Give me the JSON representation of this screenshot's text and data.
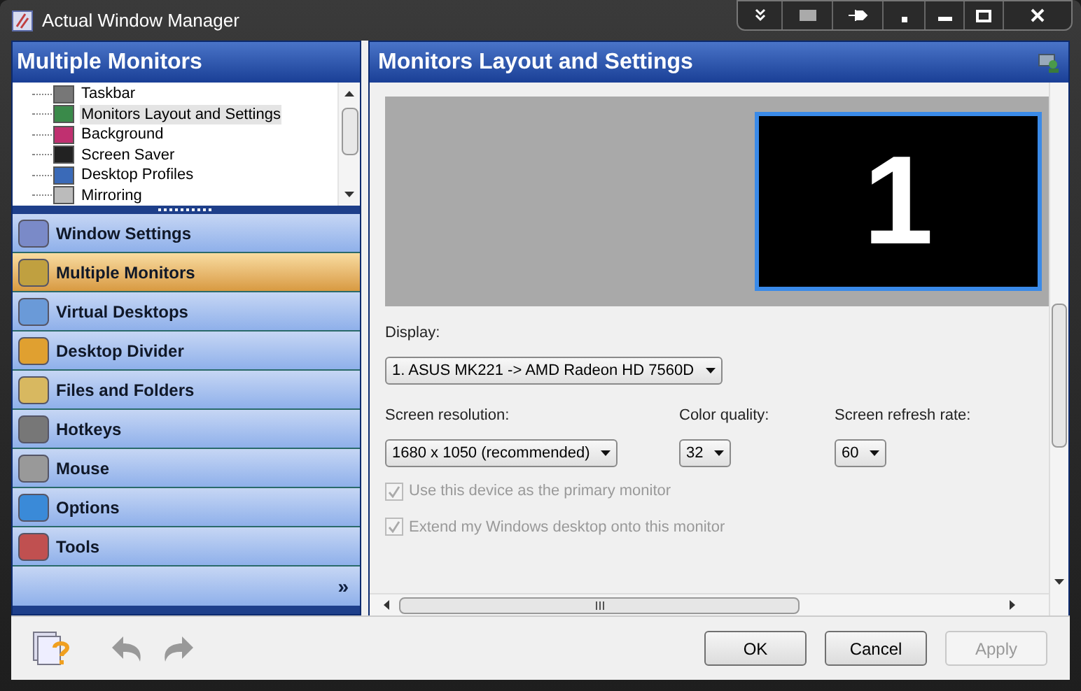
{
  "window": {
    "title": "Actual Window Manager"
  },
  "left_panel": {
    "title": "Multiple Monitors",
    "tree": [
      {
        "label": "Taskbar",
        "selected": false
      },
      {
        "label": "Monitors Layout and Settings",
        "selected": true
      },
      {
        "label": "Background",
        "selected": false
      },
      {
        "label": "Screen Saver",
        "selected": false
      },
      {
        "label": "Desktop Profiles",
        "selected": false
      },
      {
        "label": "Mirroring",
        "selected": false
      }
    ],
    "nav": [
      {
        "label": "Window Settings",
        "selected": false
      },
      {
        "label": "Multiple Monitors",
        "selected": true
      },
      {
        "label": "Virtual Desktops",
        "selected": false
      },
      {
        "label": "Desktop Divider",
        "selected": false
      },
      {
        "label": "Files and Folders",
        "selected": false
      },
      {
        "label": "Hotkeys",
        "selected": false
      },
      {
        "label": "Mouse",
        "selected": false
      },
      {
        "label": "Options",
        "selected": false
      },
      {
        "label": "Tools",
        "selected": false
      }
    ],
    "more": "»"
  },
  "right_panel": {
    "title": "Monitors Layout and Settings",
    "monitor": {
      "number": "1",
      "selected": true
    },
    "display": {
      "label": "Display:",
      "value": "1. ASUS MK221 -> AMD Radeon HD 7560D"
    },
    "fields": [
      {
        "label": "Screen resolution:",
        "value": "1680 x 1050 (recommended)"
      },
      {
        "label": "Color quality:",
        "value": "32"
      },
      {
        "label": "Screen refresh rate:",
        "value": "60"
      }
    ],
    "checkboxes": [
      {
        "label": "Use this device as the primary monitor",
        "checked": true,
        "disabled": true
      },
      {
        "label": "Extend my Windows desktop onto this monitor",
        "checked": true,
        "disabled": true
      }
    ]
  },
  "buttons": [
    {
      "label": "OK",
      "disabled": false
    },
    {
      "label": "Cancel",
      "disabled": false
    },
    {
      "label": "Apply",
      "disabled": true
    }
  ]
}
